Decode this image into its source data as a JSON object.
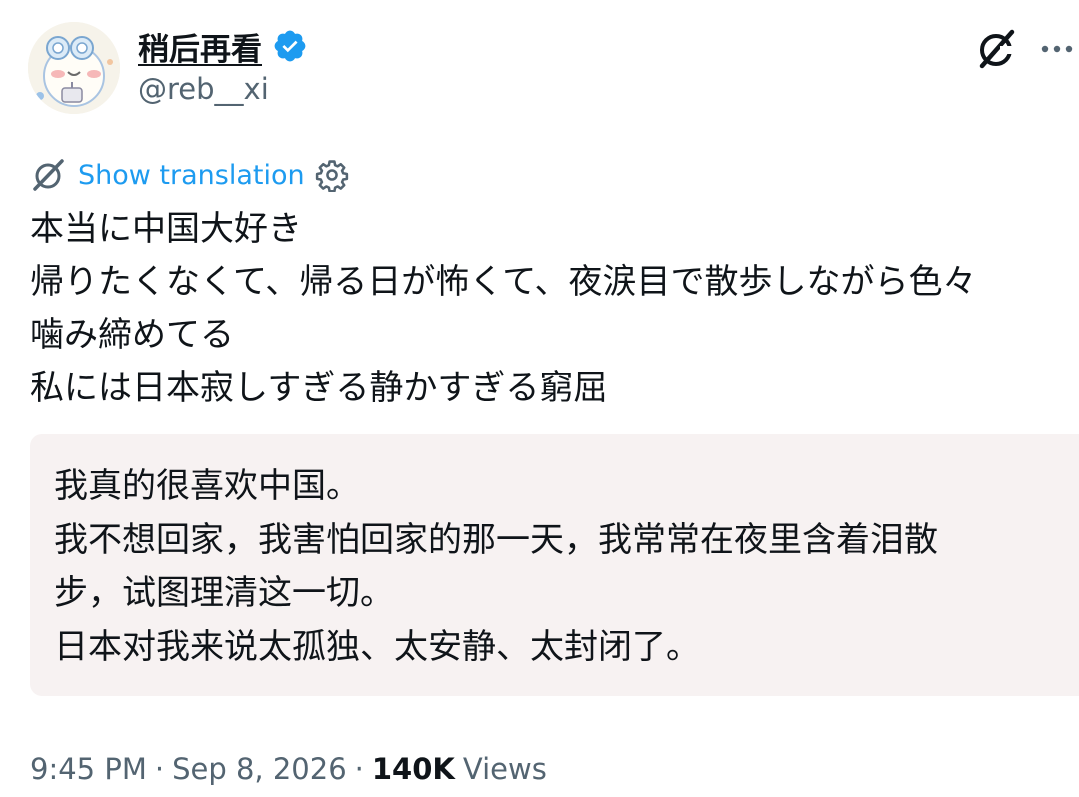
{
  "author": {
    "display_name": "稍后再看",
    "handle": "@reb__xi",
    "verified": true
  },
  "icons": {
    "verified": "verified-badge-icon",
    "grok": "grok-icon",
    "more": "more-icon",
    "translate": "grok-translate-icon",
    "gear": "gear-icon"
  },
  "translation": {
    "link_label": "Show translation"
  },
  "tweet": {
    "lines": [
      "本当に中国大好き",
      "帰りたくなくて、帰る日が怖くて、夜涙目で散歩しながら色々",
      "噛み締めてる",
      "私には日本寂しすぎる静かすぎる窮屈"
    ]
  },
  "translated": {
    "lines": [
      "我真的很喜欢中国。",
      "我不想回家，我害怕回家的那一天，我常常在夜里含着泪散",
      "步，试图理清这一切。",
      "日本对我来说太孤独、太安静、太封闭了。"
    ]
  },
  "meta": {
    "time": "9:45 PM",
    "separator": "·",
    "date": "Sep 8, 2026",
    "views_count": "140K",
    "views_label": "Views"
  },
  "colors": {
    "accent": "#1d9bf0",
    "text": "#0f1419",
    "secondary": "#536471",
    "translation_bg": "#f7f2f2"
  }
}
